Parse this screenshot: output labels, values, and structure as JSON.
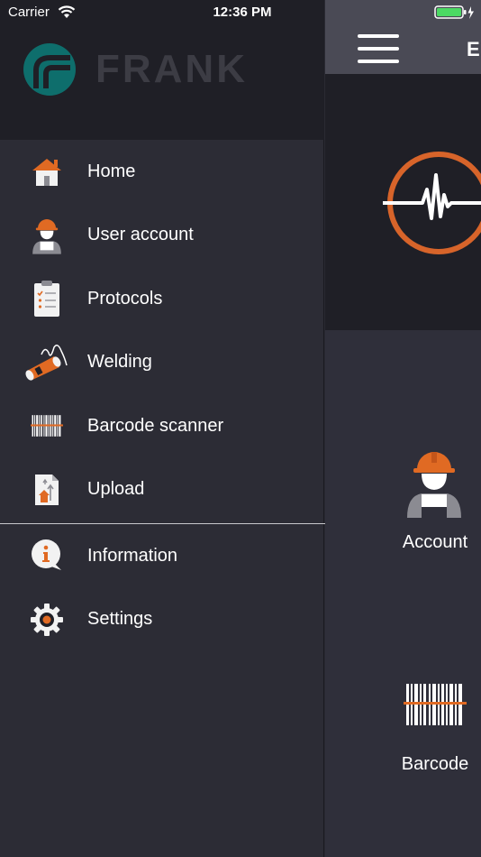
{
  "status_bar": {
    "carrier": "Carrier",
    "time": "12:36 PM"
  },
  "drawer": {
    "brand": "FRANK",
    "items": [
      {
        "label": "Home",
        "icon": "home-icon"
      },
      {
        "label": "User account",
        "icon": "worker-icon"
      },
      {
        "label": "Protocols",
        "icon": "clipboard-icon"
      },
      {
        "label": "Welding",
        "icon": "welding-icon"
      },
      {
        "label": "Barcode scanner",
        "icon": "barcode-icon"
      },
      {
        "label": "Upload",
        "icon": "upload-icon"
      }
    ],
    "secondary_items": [
      {
        "label": "Information",
        "icon": "info-icon"
      },
      {
        "label": "Settings",
        "icon": "gear-icon"
      }
    ]
  },
  "main": {
    "nav_title_fragment": "E",
    "tiles": [
      {
        "label": "Account",
        "icon": "worker-icon"
      },
      {
        "label": "Barcode",
        "icon": "barcode-icon"
      }
    ]
  },
  "colors": {
    "accent": "#e06a23",
    "brand_teal": "#0e6e6c",
    "drawer_bg": "#2c2c35"
  }
}
